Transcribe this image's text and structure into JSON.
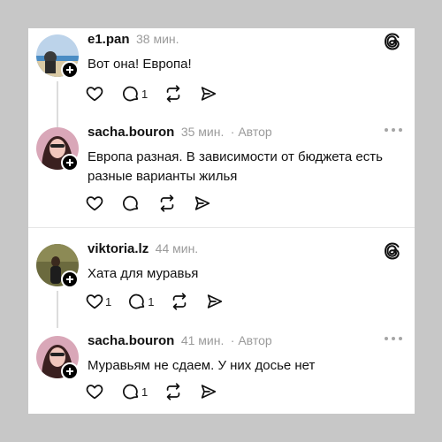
{
  "colors": {
    "background": "#c7c7c7",
    "card": "#ffffff",
    "text": "#111111",
    "muted": "#9a9a9a"
  },
  "posts": [
    {
      "username": "e1.pan",
      "time": "38 мин.",
      "author_tag": "",
      "text": "Вот она! Европа!",
      "reply_count": "1",
      "like_count": "",
      "corner_icon": "threads-logo-icon"
    },
    {
      "username": "sacha.bouron",
      "time": "35 мин.",
      "author_tag": "· Автор",
      "text": "Европа разная. В зависимости от бюджета есть разные варианты жилья",
      "reply_count": "",
      "like_count": "",
      "corner_icon": "more-icon"
    },
    {
      "username": "viktoria.lz",
      "time": "44 мин.",
      "author_tag": "",
      "text": "Хата для муравья",
      "reply_count": "1",
      "like_count": "1",
      "corner_icon": "threads-logo-icon"
    },
    {
      "username": "sacha.bouron",
      "time": "41 мин.",
      "author_tag": "· Автор",
      "text": "Муравьям не сдаем. У них досье нет",
      "reply_count": "1",
      "like_count": "",
      "corner_icon": "more-icon"
    }
  ]
}
